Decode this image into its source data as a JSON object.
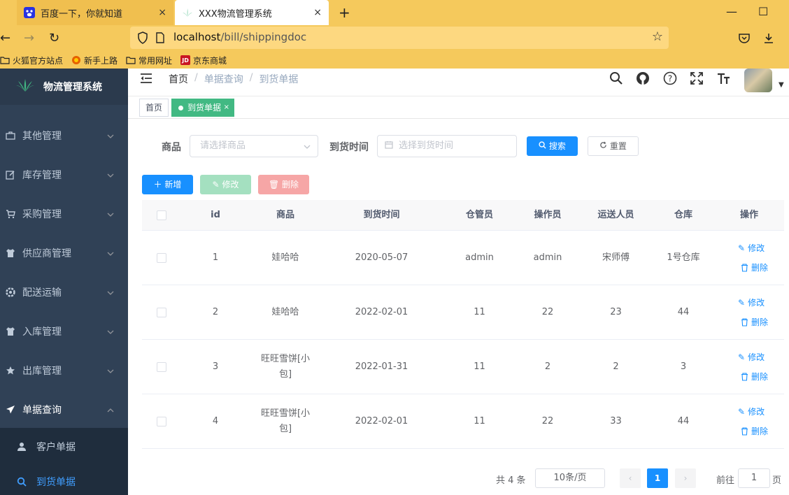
{
  "browser": {
    "tabs": [
      {
        "title": "百度一下，你就知道",
        "close": "×"
      },
      {
        "title": "XXX物流管理系统",
        "close": "×"
      }
    ],
    "new_tab": "+",
    "url_host": "localhost",
    "url_path": "/bill/shippingdoc",
    "bookmarks": [
      "火狐官方站点",
      "新手上路",
      "常用网址",
      "京东商城"
    ],
    "bookmark_jd_badge": "JD"
  },
  "sidebar": {
    "logo_text": "物流管理系统",
    "menu": [
      {
        "label": "其他管理",
        "icon": "briefcase-icon"
      },
      {
        "label": "库存管理",
        "icon": "edit-icon"
      },
      {
        "label": "采购管理",
        "icon": "cart-icon"
      },
      {
        "label": "供应商管理",
        "icon": "shirt-icon"
      },
      {
        "label": "配送运输",
        "icon": "gear-icon"
      },
      {
        "label": "入库管理",
        "icon": "shirt-icon"
      },
      {
        "label": "出库管理",
        "icon": "star-icon"
      },
      {
        "label": "单据查询",
        "icon": "send-icon"
      }
    ],
    "submenu": [
      {
        "label": "客户单据",
        "icon": "user-icon"
      },
      {
        "label": "到货单据",
        "icon": "search-icon",
        "active": true
      }
    ]
  },
  "header": {
    "breadcrumb": [
      "首页",
      "单据查询",
      "到货单据"
    ],
    "breadcrumb_sep": "/"
  },
  "tags": {
    "home": "首页",
    "active": "到货单据",
    "active_close": "×"
  },
  "filters": {
    "goods_label": "商品",
    "goods_placeholder": "请选择商品",
    "date_label": "到货时间",
    "date_placeholder": "选择到货时间",
    "search_button": "搜索",
    "reset_button": "重置"
  },
  "toolbar": {
    "add": "新增",
    "edit": "修改",
    "delete": "删除"
  },
  "table": {
    "columns": [
      "id",
      "商品",
      "到货时间",
      "仓管员",
      "操作员",
      "运送人员",
      "仓库",
      "操作"
    ],
    "rows": [
      {
        "id": "1",
        "goods": "娃哈哈",
        "date": "2020-05-07",
        "keeper": "admin",
        "operator": "admin",
        "shipper": "宋师傅",
        "warehouse": "1号仓库"
      },
      {
        "id": "2",
        "goods": "娃哈哈",
        "date": "2022-02-01",
        "keeper": "11",
        "operator": "22",
        "shipper": "23",
        "warehouse": "44"
      },
      {
        "id": "3",
        "goods": "旺旺雪饼[小包]",
        "date": "2022-01-31",
        "keeper": "11",
        "operator": "2",
        "shipper": "2",
        "warehouse": "3"
      },
      {
        "id": "4",
        "goods": "旺旺雪饼[小包]",
        "date": "2022-02-01",
        "keeper": "11",
        "operator": "22",
        "shipper": "33",
        "warehouse": "44"
      }
    ],
    "row_edit": "修改",
    "row_delete": "删除"
  },
  "pagination": {
    "total_text": "共 4 条",
    "page_size": "10条/页",
    "current_page": "1",
    "goto_label": "前往",
    "goto_value": "1",
    "page_suffix": "页"
  },
  "colors": {
    "sidebar_bg": "#304156",
    "primary": "#1890ff",
    "tag_active": "#42b983",
    "browser_chrome": "#f5c95c"
  }
}
